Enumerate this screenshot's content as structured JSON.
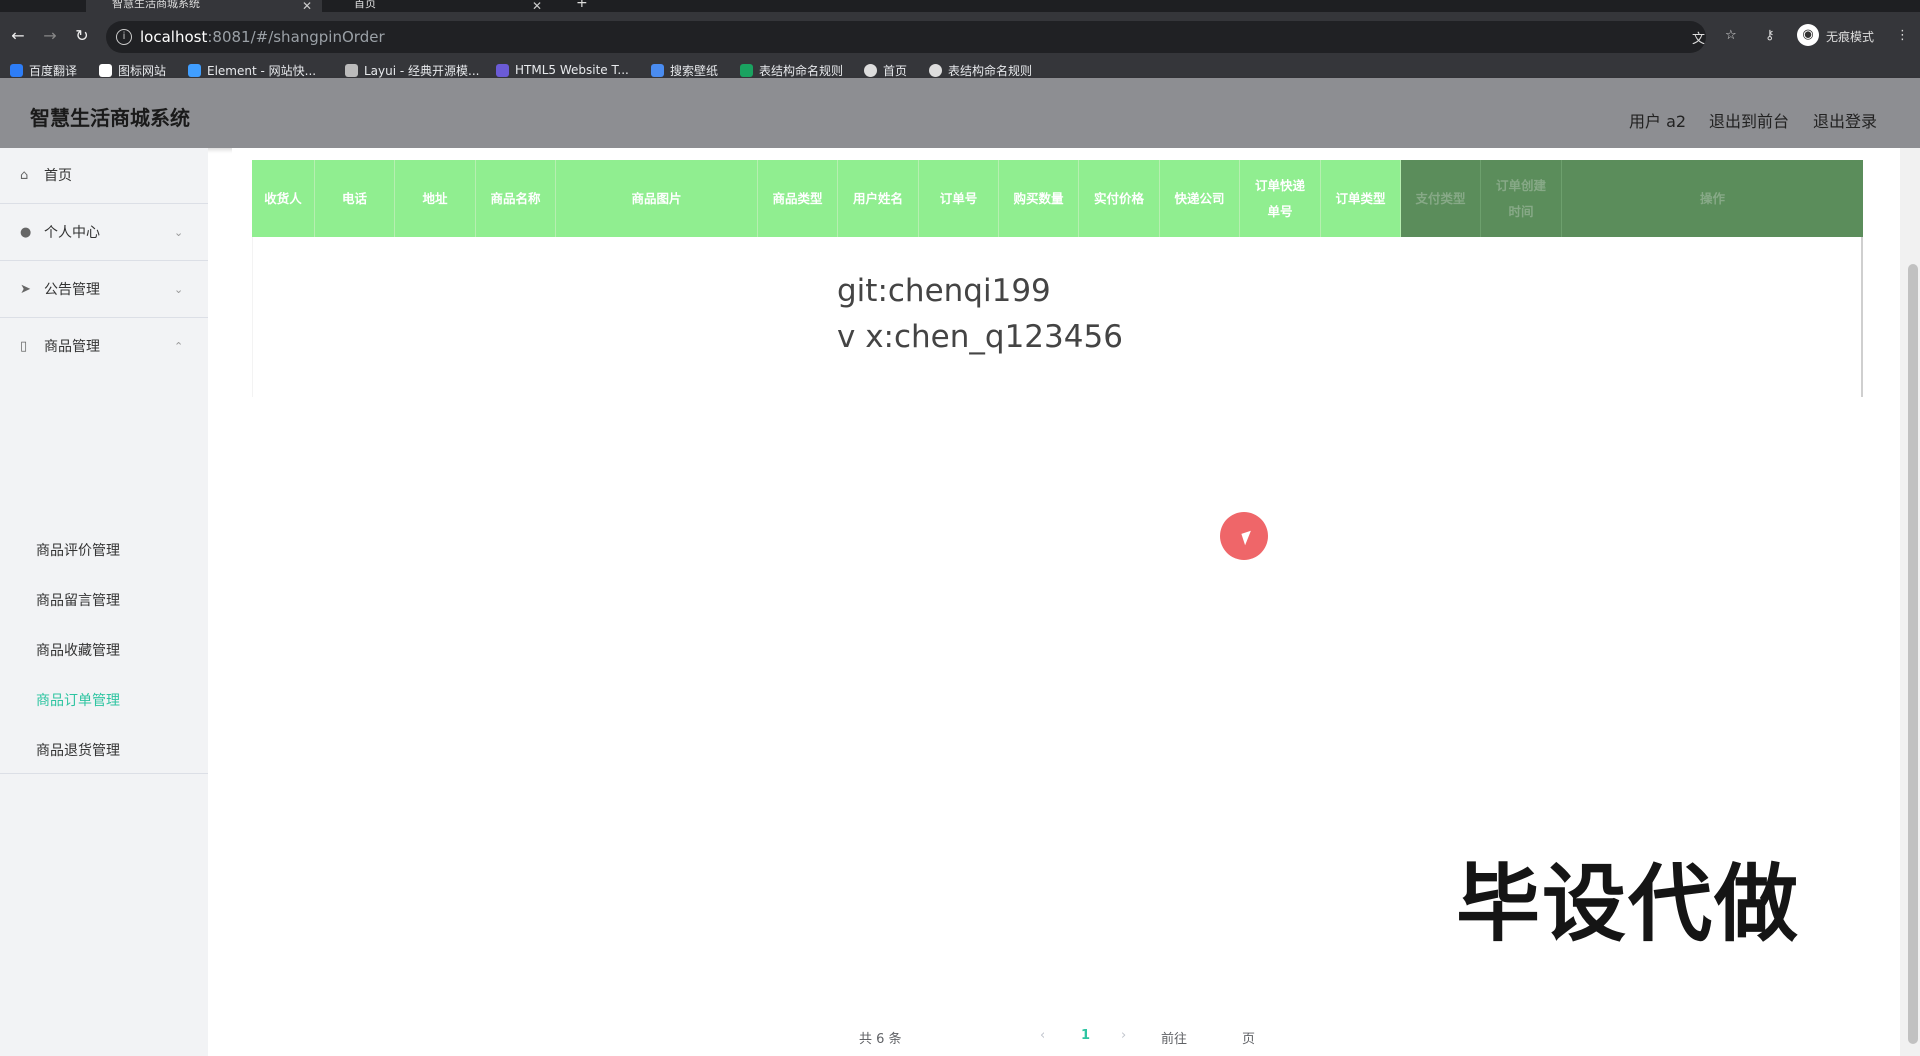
{
  "browser": {
    "tabs": [
      {
        "title": "智慧生活商城系统",
        "close": "✕"
      },
      {
        "title": "首页",
        "close": "✕"
      }
    ],
    "new_tab": "+",
    "url": {
      "host": "localhost",
      "path": ":8081/#/shangpinOrder"
    },
    "incognito_label": "无痕模式",
    "bookmarks": [
      "百度翻译",
      "图标网站",
      "Element - 网站快...",
      "Layui - 经典开源模...",
      "HTML5 Website T...",
      "搜索壁纸",
      "表结构命名规则",
      "首页",
      "表结构命名规则"
    ]
  },
  "header": {
    "title": "智慧生活商城系统",
    "user": "用户 a2",
    "front": "退出到前台",
    "logout": "退出登录"
  },
  "sidebar": {
    "home": "首页",
    "personal": "个人中心",
    "notice": "公告管理",
    "goods": "商品管理",
    "sub": [
      "商品评价管理",
      "商品留言管理",
      "商品收藏管理",
      "商品订单管理",
      "商品退货管理"
    ]
  },
  "table": {
    "headers": [
      "收货人",
      "电话",
      "地址",
      "商品名称",
      "商品图片",
      "商品类型",
      "用户姓名",
      "订单号",
      "购买数量",
      "实付价格",
      "快递公司",
      "订单快递单号",
      "订单类型",
      "支付类型",
      "订单创建时间",
      "操作"
    ]
  },
  "watermark": {
    "line1": "git:chenqi199",
    "line2": "v x:chen_q123456"
  },
  "stamp": "毕设代做",
  "pagination": {
    "total": "共 6 条",
    "page": "1",
    "goto": "前往",
    "page_unit": "页"
  },
  "colors": {
    "header_green": "#90ee90",
    "header_dark": "#5b8d5b",
    "active_menu": "#2ec4a1",
    "header_bar": "#8d8e92"
  }
}
